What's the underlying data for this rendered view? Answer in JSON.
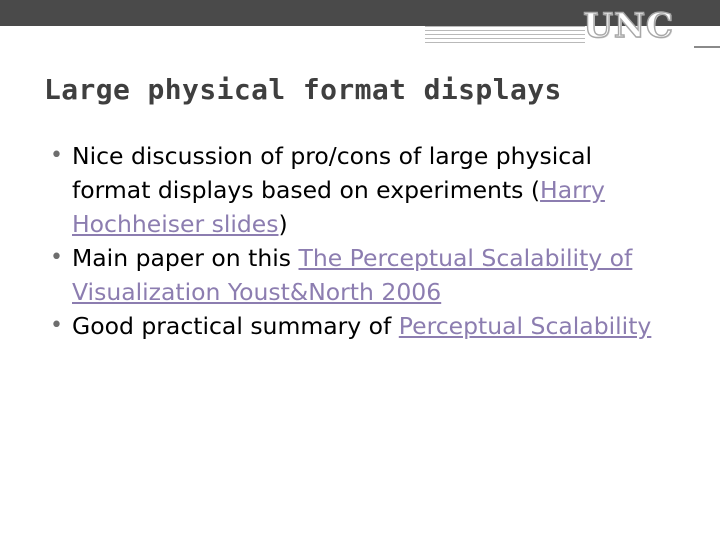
{
  "slide": {
    "logo_text": "UNC",
    "title": "Large physical format displays",
    "bullet_mark": "•",
    "bullets": [
      {
        "before": "Nice discussion of pro/cons of large physical format displays based on experiments (",
        "link": "Harry Hochheiser slides",
        "after": ")"
      },
      {
        "before": "Main paper on this ",
        "link": "The Perceptual Scalability of Visualization Youst&North 2006",
        "after": ""
      },
      {
        "before": "Good practical summary of ",
        "link": "Perceptual Scalability",
        "after": ""
      }
    ]
  },
  "colors": {
    "topbar": "#4a4a4a",
    "title": "#3f3f3f",
    "link": "#8c7db0",
    "bullet_mark": "#6e6e6e"
  }
}
